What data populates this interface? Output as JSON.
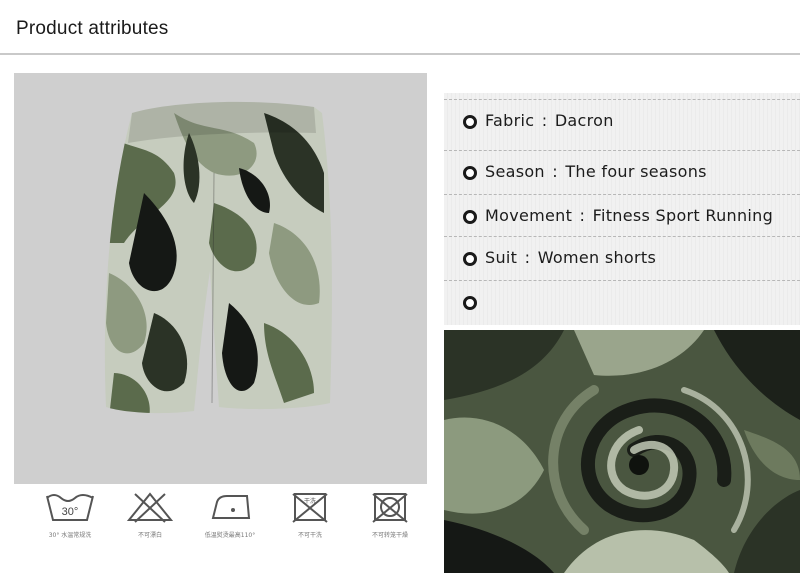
{
  "header": {
    "title": "Product attributes"
  },
  "attributes": [
    {
      "label": "Fabric",
      "value": "Dacron"
    },
    {
      "label": "Season",
      "value": "The four seasons"
    },
    {
      "label": "Movement",
      "value": "Fitness Sport Running"
    },
    {
      "label": "Suit",
      "value": "Women shorts"
    },
    {
      "label": "",
      "value": ""
    }
  ],
  "attribute_separator": ":",
  "care_icons": [
    {
      "icon": "wash-30-icon",
      "symbol_text": "30°",
      "caption": "30° 水温常规洗"
    },
    {
      "icon": "no-bleach-icon",
      "symbol_text": "",
      "caption": "不可漂白"
    },
    {
      "icon": "iron-low-icon",
      "symbol_text": "",
      "caption": "低温熨烫最高110°"
    },
    {
      "icon": "no-dry-clean-icon",
      "symbol_text": "干洗",
      "caption": "不可干洗"
    },
    {
      "icon": "no-tumble-dry-icon",
      "symbol_text": "",
      "caption": "不可转笼干燥"
    }
  ],
  "colors": {
    "camo_light": "#c9cfc0",
    "camo_sage": "#8e9a80",
    "camo_olive": "#5b6b4c",
    "camo_dark": "#2b3326",
    "camo_black": "#151815",
    "background_gray": "#cfcfcf"
  }
}
